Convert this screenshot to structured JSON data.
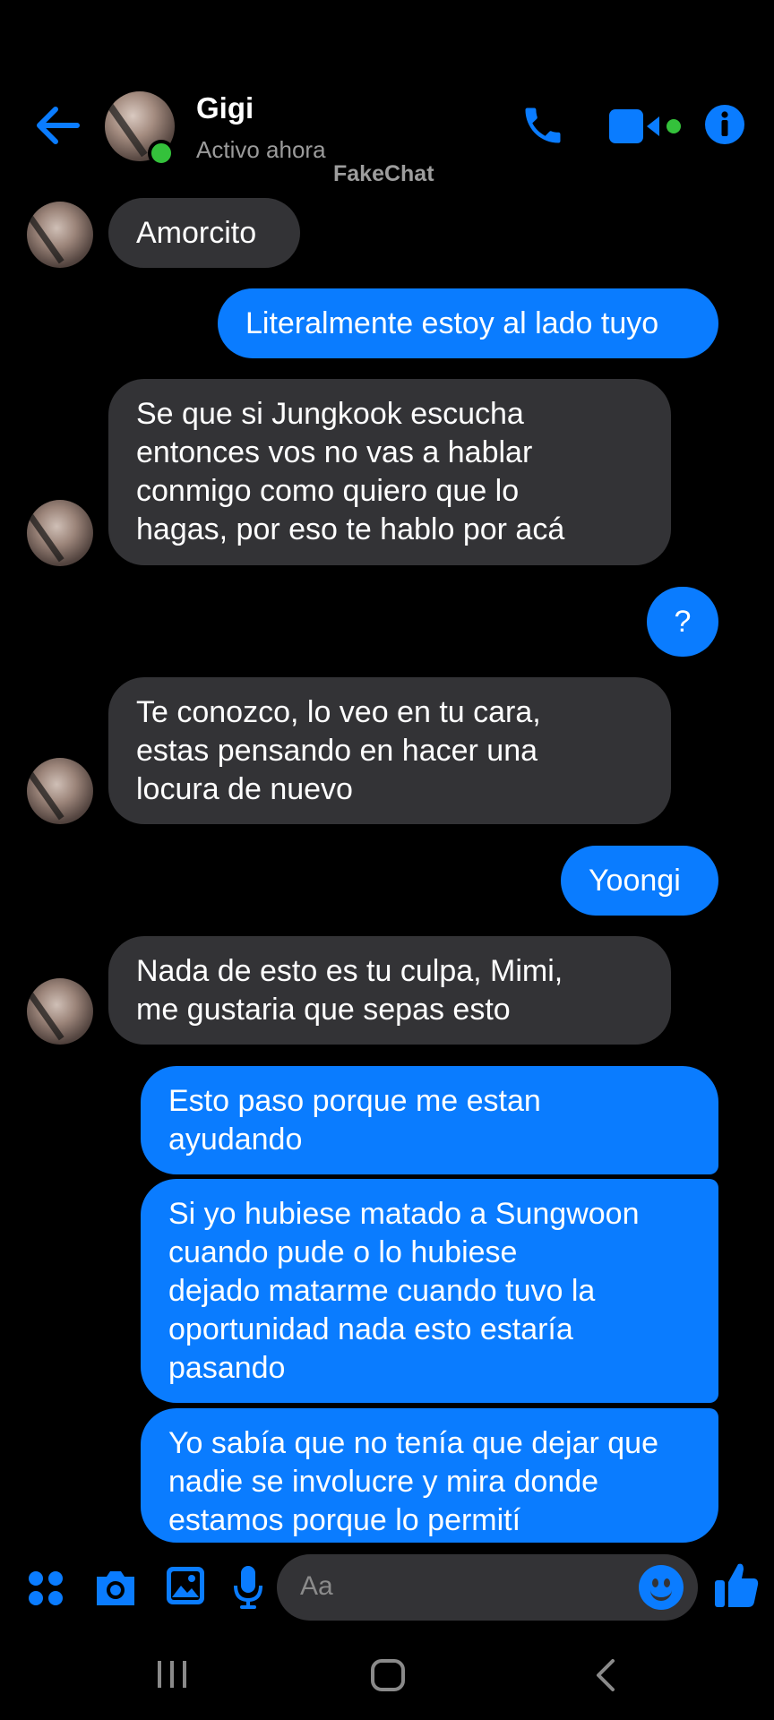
{
  "header": {
    "contact_name": "Gigi",
    "status": "Activo ahora",
    "watermark": "FakeChat",
    "accent_color": "#0a7cff",
    "online_color": "#34c13b",
    "icons": [
      "back-arrow-icon",
      "phone-icon",
      "video-camera-icon",
      "info-icon"
    ]
  },
  "messages": [
    {
      "side": "in",
      "text": "Amorcito"
    },
    {
      "side": "out",
      "text": "Literalmente estoy al lado tuyo"
    },
    {
      "side": "in",
      "lines": [
        "Se que si Jungkook escucha",
        "entonces vos no vas a hablar",
        "conmigo como quiero que lo",
        "hagas, por eso te hablo por acá"
      ]
    },
    {
      "side": "out",
      "text": "?"
    },
    {
      "side": "in",
      "lines": [
        "Te conozco, lo veo en tu cara,",
        "estas pensando en hacer una",
        "locura de nuevo"
      ]
    },
    {
      "side": "out",
      "text": "Yoongi"
    },
    {
      "side": "in",
      "lines": [
        "Nada de esto es tu culpa, Mimi,",
        "me gustaria que sepas esto"
      ]
    },
    {
      "side": "out",
      "lines": [
        "Esto paso porque me estan",
        "ayudando"
      ]
    },
    {
      "side": "out",
      "lines": [
        "Si yo hubiese matado a Sungwoon",
        "cuando pude o lo hubiese",
        "dejado matarme cuando tuvo la",
        "oportunidad nada esto estaría",
        "pasando"
      ]
    },
    {
      "side": "out",
      "lines": [
        "Yo sabía que no tenía que dejar que",
        "nadie se involucre y mira donde",
        "estamos porque lo permití"
      ]
    }
  ],
  "composer": {
    "placeholder": "Aa",
    "icons": [
      "apps-icon",
      "camera-icon",
      "gallery-icon",
      "microphone-icon",
      "emoji-icon",
      "thumbs-up-icon"
    ]
  },
  "navbar": {
    "icons": [
      "recent-apps-icon",
      "home-icon",
      "back-icon"
    ]
  }
}
